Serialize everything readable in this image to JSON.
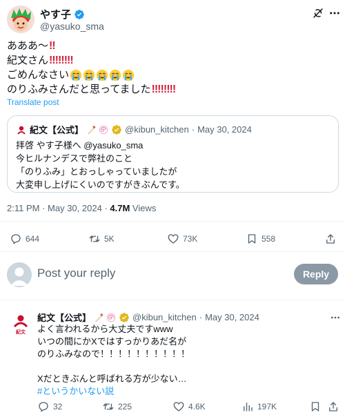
{
  "post": {
    "author_name": "やす子",
    "author_handle": "@yasuko_sma",
    "lines": [
      {
        "text": "あああ〜",
        "bangs": "‼"
      },
      {
        "text": "紀文さん",
        "bangs": "‼‼‼‼"
      },
      {
        "text": "ごめんなさい",
        "bangs": ""
      },
      {
        "text": "のりふみさんだと思ってました",
        "bangs": "‼‼‼‼"
      }
    ],
    "translate_label": "Translate post",
    "time": "2:11 PM",
    "date": "May 30, 2024",
    "views_count": "4.7M",
    "views_label": "Views",
    "stats": {
      "replies": "644",
      "reposts": "5K",
      "likes": "73K",
      "bookmarks": "558"
    }
  },
  "quote": {
    "author_name": "紀文【公式】",
    "author_handle": "@kibun_kitchen",
    "date": "May 30, 2024",
    "lines": [
      "拝啓 やす子様へ @yasuko_sma",
      "今ヒルナンデスで弊社のこと",
      "「のりふみ」とおっしゃっていましたが",
      "大変申し上げにくいのですがきぶんです。"
    ]
  },
  "composer": {
    "placeholder": "Post your reply",
    "reply_button": "Reply"
  },
  "reply": {
    "author_name": "紀文【公式】",
    "author_handle": "@kibun_kitchen",
    "date": "May 30, 2024",
    "logo_text": "紀文",
    "lines": [
      "よく言われるから大丈夫ですwww",
      "いつの間にかXではすっかりあだ名が",
      "のりふみなので！！！！！！！！！！",
      "",
      "Xだときぶんと呼ばれる方が少ない…"
    ],
    "hashtag": "#というかいない説",
    "stats": {
      "replies": "32",
      "reposts": "225",
      "likes": "4.6K",
      "views": "197K"
    }
  },
  "colors": {
    "accent": "#1d9bf0",
    "verified_gold": "#e2b719",
    "bang_red": "#d4213a",
    "kibun_red": "#c8102e",
    "muted": "#536471"
  }
}
